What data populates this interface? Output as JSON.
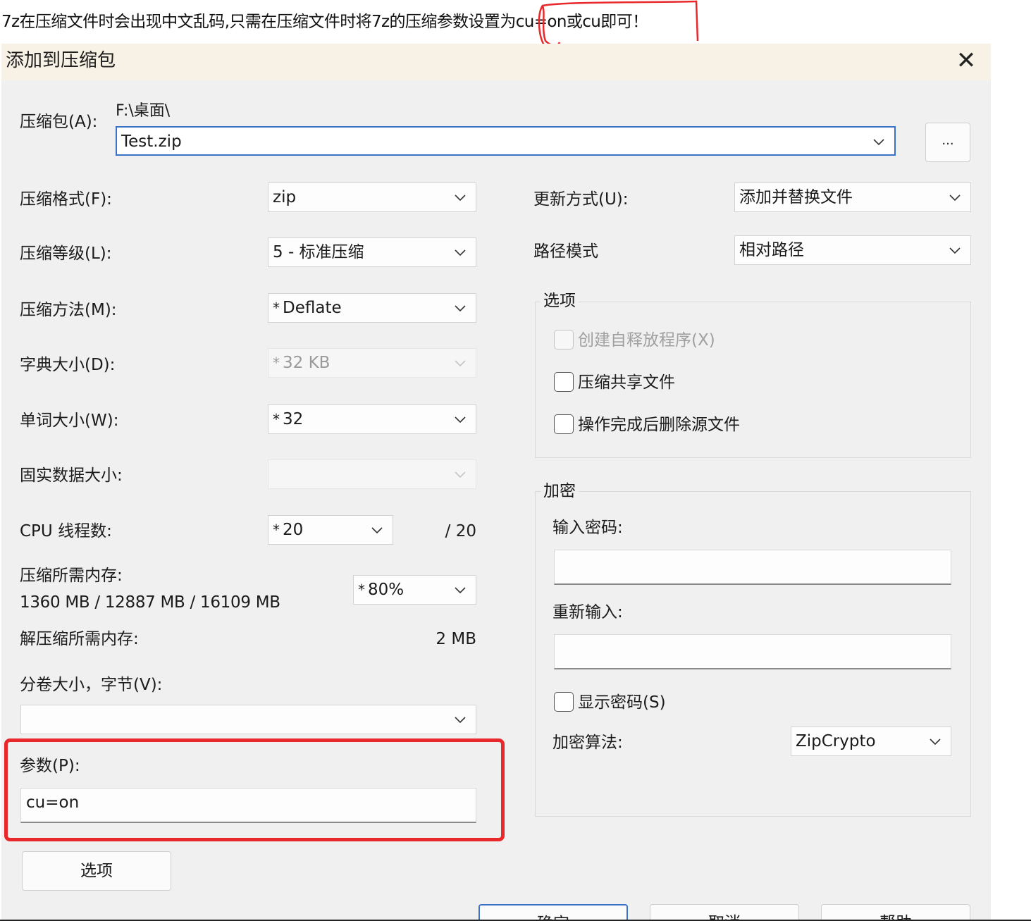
{
  "note": {
    "text": "7z在压缩文件时会出现中文乱码,只需在压缩文件时将7z的压缩参数设置为cu=on或cu即可！",
    "highlight_color": "#e8282a"
  },
  "dialog": {
    "title": "添加到压缩包",
    "close_icon": "close-icon"
  },
  "archive": {
    "label": "压缩包(A):",
    "path": "F:\\桌面\\",
    "filename": "Test.zip",
    "browse_label": "..."
  },
  "left": {
    "format": {
      "label": "压缩格式(F):",
      "value": "zip"
    },
    "level": {
      "label": "压缩等级(L):",
      "value": "5 - 标准压缩"
    },
    "method": {
      "label": "压缩方法(M):",
      "star": "*",
      "value": "Deflate"
    },
    "dict": {
      "label": "字典大小(D):",
      "star": "*",
      "value": "32 KB"
    },
    "word": {
      "label": "单词大小(W):",
      "star": "*",
      "value": "32"
    },
    "solid": {
      "label": "固实数据大小:",
      "value": ""
    },
    "cpu": {
      "label": "CPU 线程数:",
      "star": "*",
      "value": "20",
      "total": "/ 20"
    },
    "mem": {
      "label": "压缩所需内存:",
      "detail": "1360 MB / 12887 MB / 16109 MB",
      "star": "*",
      "value": "80%"
    },
    "decomp": {
      "label": "解压缩所需内存:",
      "value": "2 MB"
    },
    "volume": {
      "label": "分卷大小，字节(V):",
      "value": ""
    },
    "params": {
      "label": "参数(P):",
      "value": "cu=on"
    },
    "options_button": "选项"
  },
  "right": {
    "update": {
      "label": "更新方式(U):",
      "value": "添加并替换文件"
    },
    "path_mode": {
      "label": "路径模式",
      "value": "相对路径"
    },
    "options_group": {
      "title": "选项",
      "sfx": "创建自释放程序(X)",
      "shared": "压缩共享文件",
      "delete": "操作完成后删除源文件"
    },
    "encrypt_group": {
      "title": "加密",
      "password_label": "输入密码:",
      "reenter_label": "重新输入:",
      "show_password": "显示密码(S)",
      "algo_label": "加密算法:",
      "algo_value": "ZipCrypto"
    }
  },
  "footer": {
    "ok": "确定",
    "cancel": "取消",
    "help": "帮助"
  }
}
